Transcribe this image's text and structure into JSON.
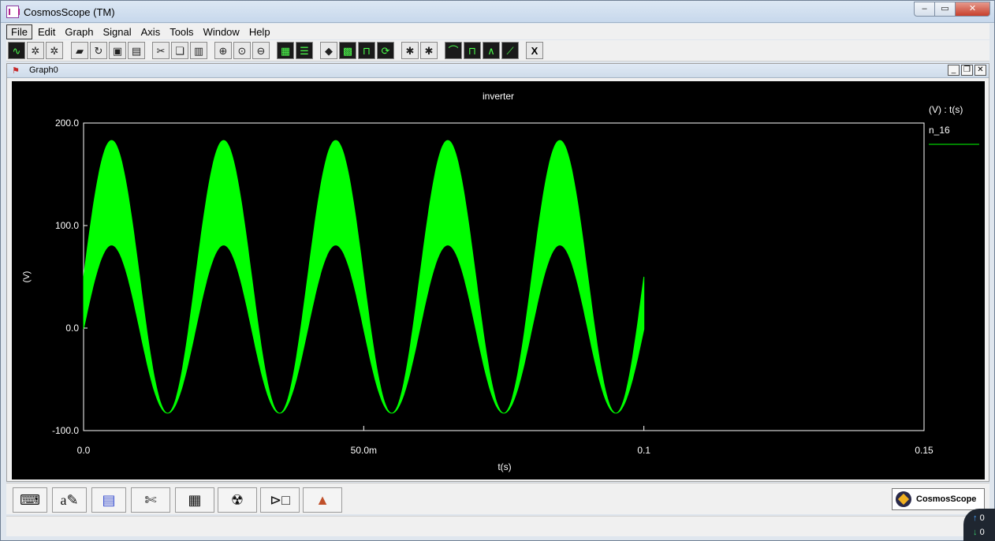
{
  "window": {
    "title": "CosmosScope (TM)",
    "buttons": {
      "minimize": "‒",
      "maximize": "▭",
      "close": "✕"
    }
  },
  "menu": [
    {
      "label": "File"
    },
    {
      "label": "Edit"
    },
    {
      "label": "Graph"
    },
    {
      "label": "Signal"
    },
    {
      "label": "Axis"
    },
    {
      "label": "Tools"
    },
    {
      "label": "Window"
    },
    {
      "label": "Help"
    }
  ],
  "toolbar_icons": [
    "waveform-icon",
    "zoom-wheel-icon",
    "pan-wheel-icon",
    "open-folder-icon",
    "reload-icon",
    "save-icon",
    "print-icon",
    "cut-icon",
    "copy-icon",
    "paste-icon",
    "zoom-in-icon",
    "zoom-fit-icon",
    "zoom-out-icon",
    "stack-icon",
    "stack-all-icon",
    "eraser-icon",
    "grid-icon",
    "digital-icon",
    "refresh-icon",
    "bug-icon",
    "bug-list-icon",
    "measure-rise-icon",
    "measure-pulse-icon",
    "measure-peak-icon",
    "measure-slope-icon",
    "close-x-icon"
  ],
  "graph_window": {
    "title": "Graph0",
    "buttons": {
      "minimize": "_",
      "restore": "❐",
      "close": "✕"
    }
  },
  "chart_data": {
    "type": "line",
    "title": "inverter",
    "xlabel": "t(s)",
    "ylabel": "(V)",
    "xlim": [
      0,
      0.15
    ],
    "ylim": [
      -100,
      200
    ],
    "x_ticks": [
      "0.0",
      "50.0m",
      "0.1",
      "0.15"
    ],
    "y_ticks": [
      "200.0",
      "100.0",
      "0.0",
      "-100.0"
    ],
    "legend_header": "(V) : t(s)",
    "series": [
      {
        "name": "n_16",
        "color": "#00ff00",
        "x_range": [
          0,
          0.1
        ],
        "frequency_hz": 50,
        "upper_envelope": {
          "offset": 50,
          "amplitude": 133
        },
        "lower_envelope": {
          "offset": -1,
          "amplitude": 82
        }
      }
    ],
    "grid": false,
    "legend": "right"
  },
  "bottom_tools": [
    "keyboard-icon",
    "annotate-icon",
    "waveform-calc-icon",
    "signal-edit-icon",
    "calculator-icon",
    "radiation-icon",
    "block-diagram-icon",
    "matlab-icon"
  ],
  "brand": {
    "label": "CosmosScope"
  },
  "tray": {
    "up": "0",
    "down": "0"
  }
}
